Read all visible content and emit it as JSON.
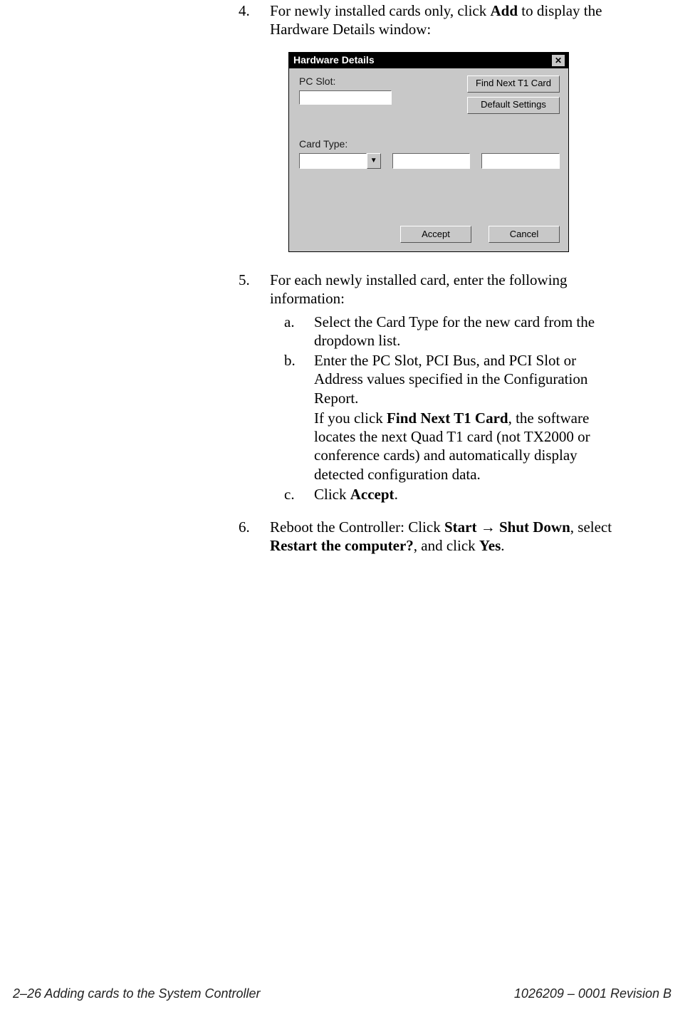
{
  "steps": {
    "s4": {
      "num": "4.",
      "text_before": "For newly installed cards only, click ",
      "bold_add": "Add",
      "text_after": " to display the Hardware Details window:"
    },
    "s5": {
      "num": "5.",
      "intro": "For each newly installed card, enter the following information:",
      "a": {
        "mark": "a.",
        "text": "Select the Card Type for the new card from the dropdown list."
      },
      "b": {
        "mark": "b.",
        "line1": "Enter the PC Slot, PCI Bus, and PCI Slot or Address values specified in the Configuration Report.",
        "line2_before": "If you click ",
        "line2_bold": "Find Next T1 Card",
        "line2_after": ", the software locates the next Quad T1 card (not TX2000 or conference cards) and automatically display detected configuration data."
      },
      "c": {
        "mark": "c.",
        "text_before": "Click ",
        "bold": "Accept",
        "text_after": "."
      }
    },
    "s6": {
      "num": "6.",
      "t1": "Reboot the Controller: Click ",
      "b1": "Start",
      "arrow": " → ",
      "b2": "Shut Down",
      "t2": ", select ",
      "b3": "Restart the computer?",
      "t3": ", and click ",
      "b4": "Yes",
      "t4": "."
    }
  },
  "dialog": {
    "title": "Hardware Details",
    "close_glyph": "✕",
    "pc_slot_label": "PC Slot:",
    "card_type_label": "Card Type:",
    "btn_find": "Find Next T1 Card",
    "btn_defaults": "Default Settings",
    "btn_accept": "Accept",
    "btn_cancel": "Cancel",
    "dropdown_glyph": "▼"
  },
  "footer": {
    "left": "2–26  Adding cards to the System Controller",
    "right": "1026209 – 0001  Revision B"
  }
}
